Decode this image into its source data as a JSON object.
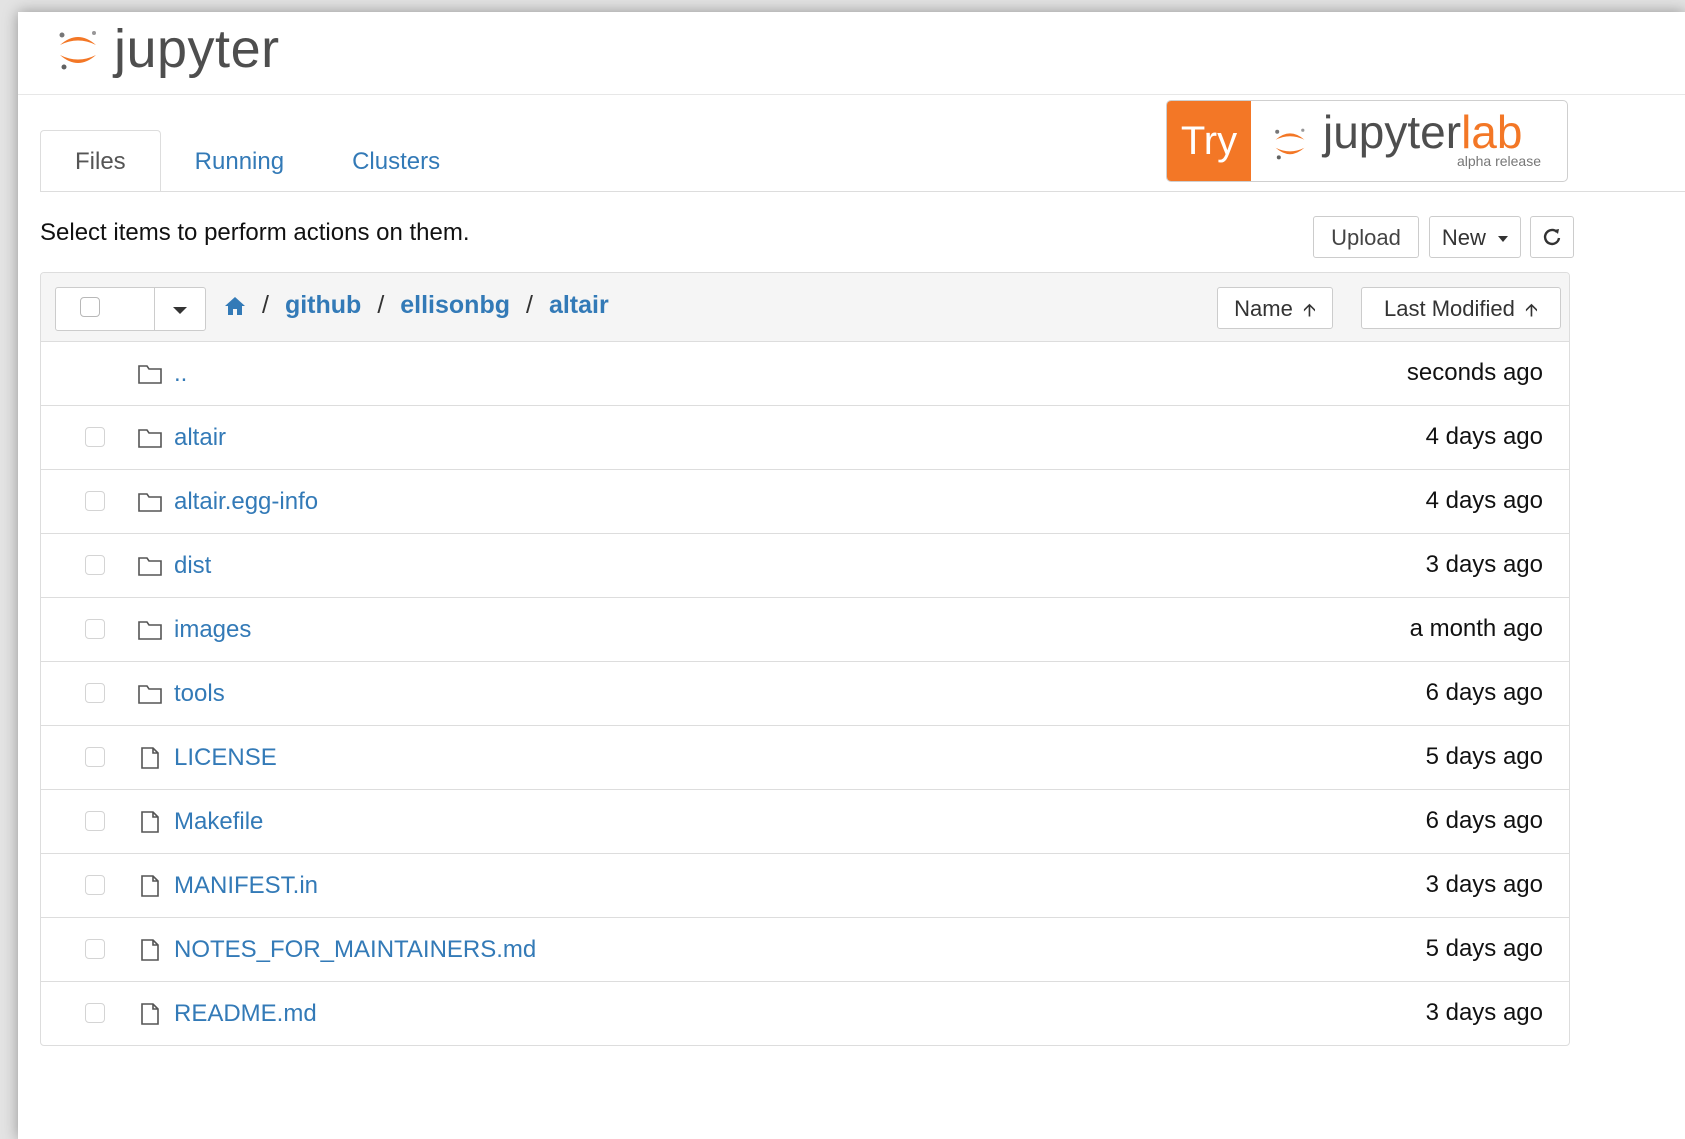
{
  "app": {
    "logo_text": "jupyter"
  },
  "tabs": [
    {
      "label": "Files",
      "active": true
    },
    {
      "label": "Running",
      "active": false
    },
    {
      "label": "Clusters",
      "active": false
    }
  ],
  "banner": {
    "try": "Try",
    "jupyter": "jupyter",
    "lab": "lab",
    "alpha": "alpha release"
  },
  "toolbar": {
    "hint": "Select items to perform actions on them.",
    "upload": "Upload",
    "new": "New",
    "refresh_icon": "refresh-icon"
  },
  "breadcrumb": {
    "home_icon": "home-icon",
    "parts": [
      "github",
      "ellisonbg",
      "altair"
    ]
  },
  "sort": {
    "name": "Name",
    "modified": "Last Modified"
  },
  "colors": {
    "link": "#337ab7",
    "accent": "#f37726"
  },
  "files": [
    {
      "name": "..",
      "type": "folder",
      "modified": "seconds ago",
      "checkbox": false
    },
    {
      "name": "altair",
      "type": "folder",
      "modified": "4 days ago",
      "checkbox": true
    },
    {
      "name": "altair.egg-info",
      "type": "folder",
      "modified": "4 days ago",
      "checkbox": true
    },
    {
      "name": "dist",
      "type": "folder",
      "modified": "3 days ago",
      "checkbox": true
    },
    {
      "name": "images",
      "type": "folder",
      "modified": "a month ago",
      "checkbox": true
    },
    {
      "name": "tools",
      "type": "folder",
      "modified": "6 days ago",
      "checkbox": true
    },
    {
      "name": "LICENSE",
      "type": "file",
      "modified": "5 days ago",
      "checkbox": true
    },
    {
      "name": "Makefile",
      "type": "file",
      "modified": "6 days ago",
      "checkbox": true
    },
    {
      "name": "MANIFEST.in",
      "type": "file",
      "modified": "3 days ago",
      "checkbox": true
    },
    {
      "name": "NOTES_FOR_MAINTAINERS.md",
      "type": "file",
      "modified": "5 days ago",
      "checkbox": true
    },
    {
      "name": "README.md",
      "type": "file",
      "modified": "3 days ago",
      "checkbox": true
    }
  ]
}
